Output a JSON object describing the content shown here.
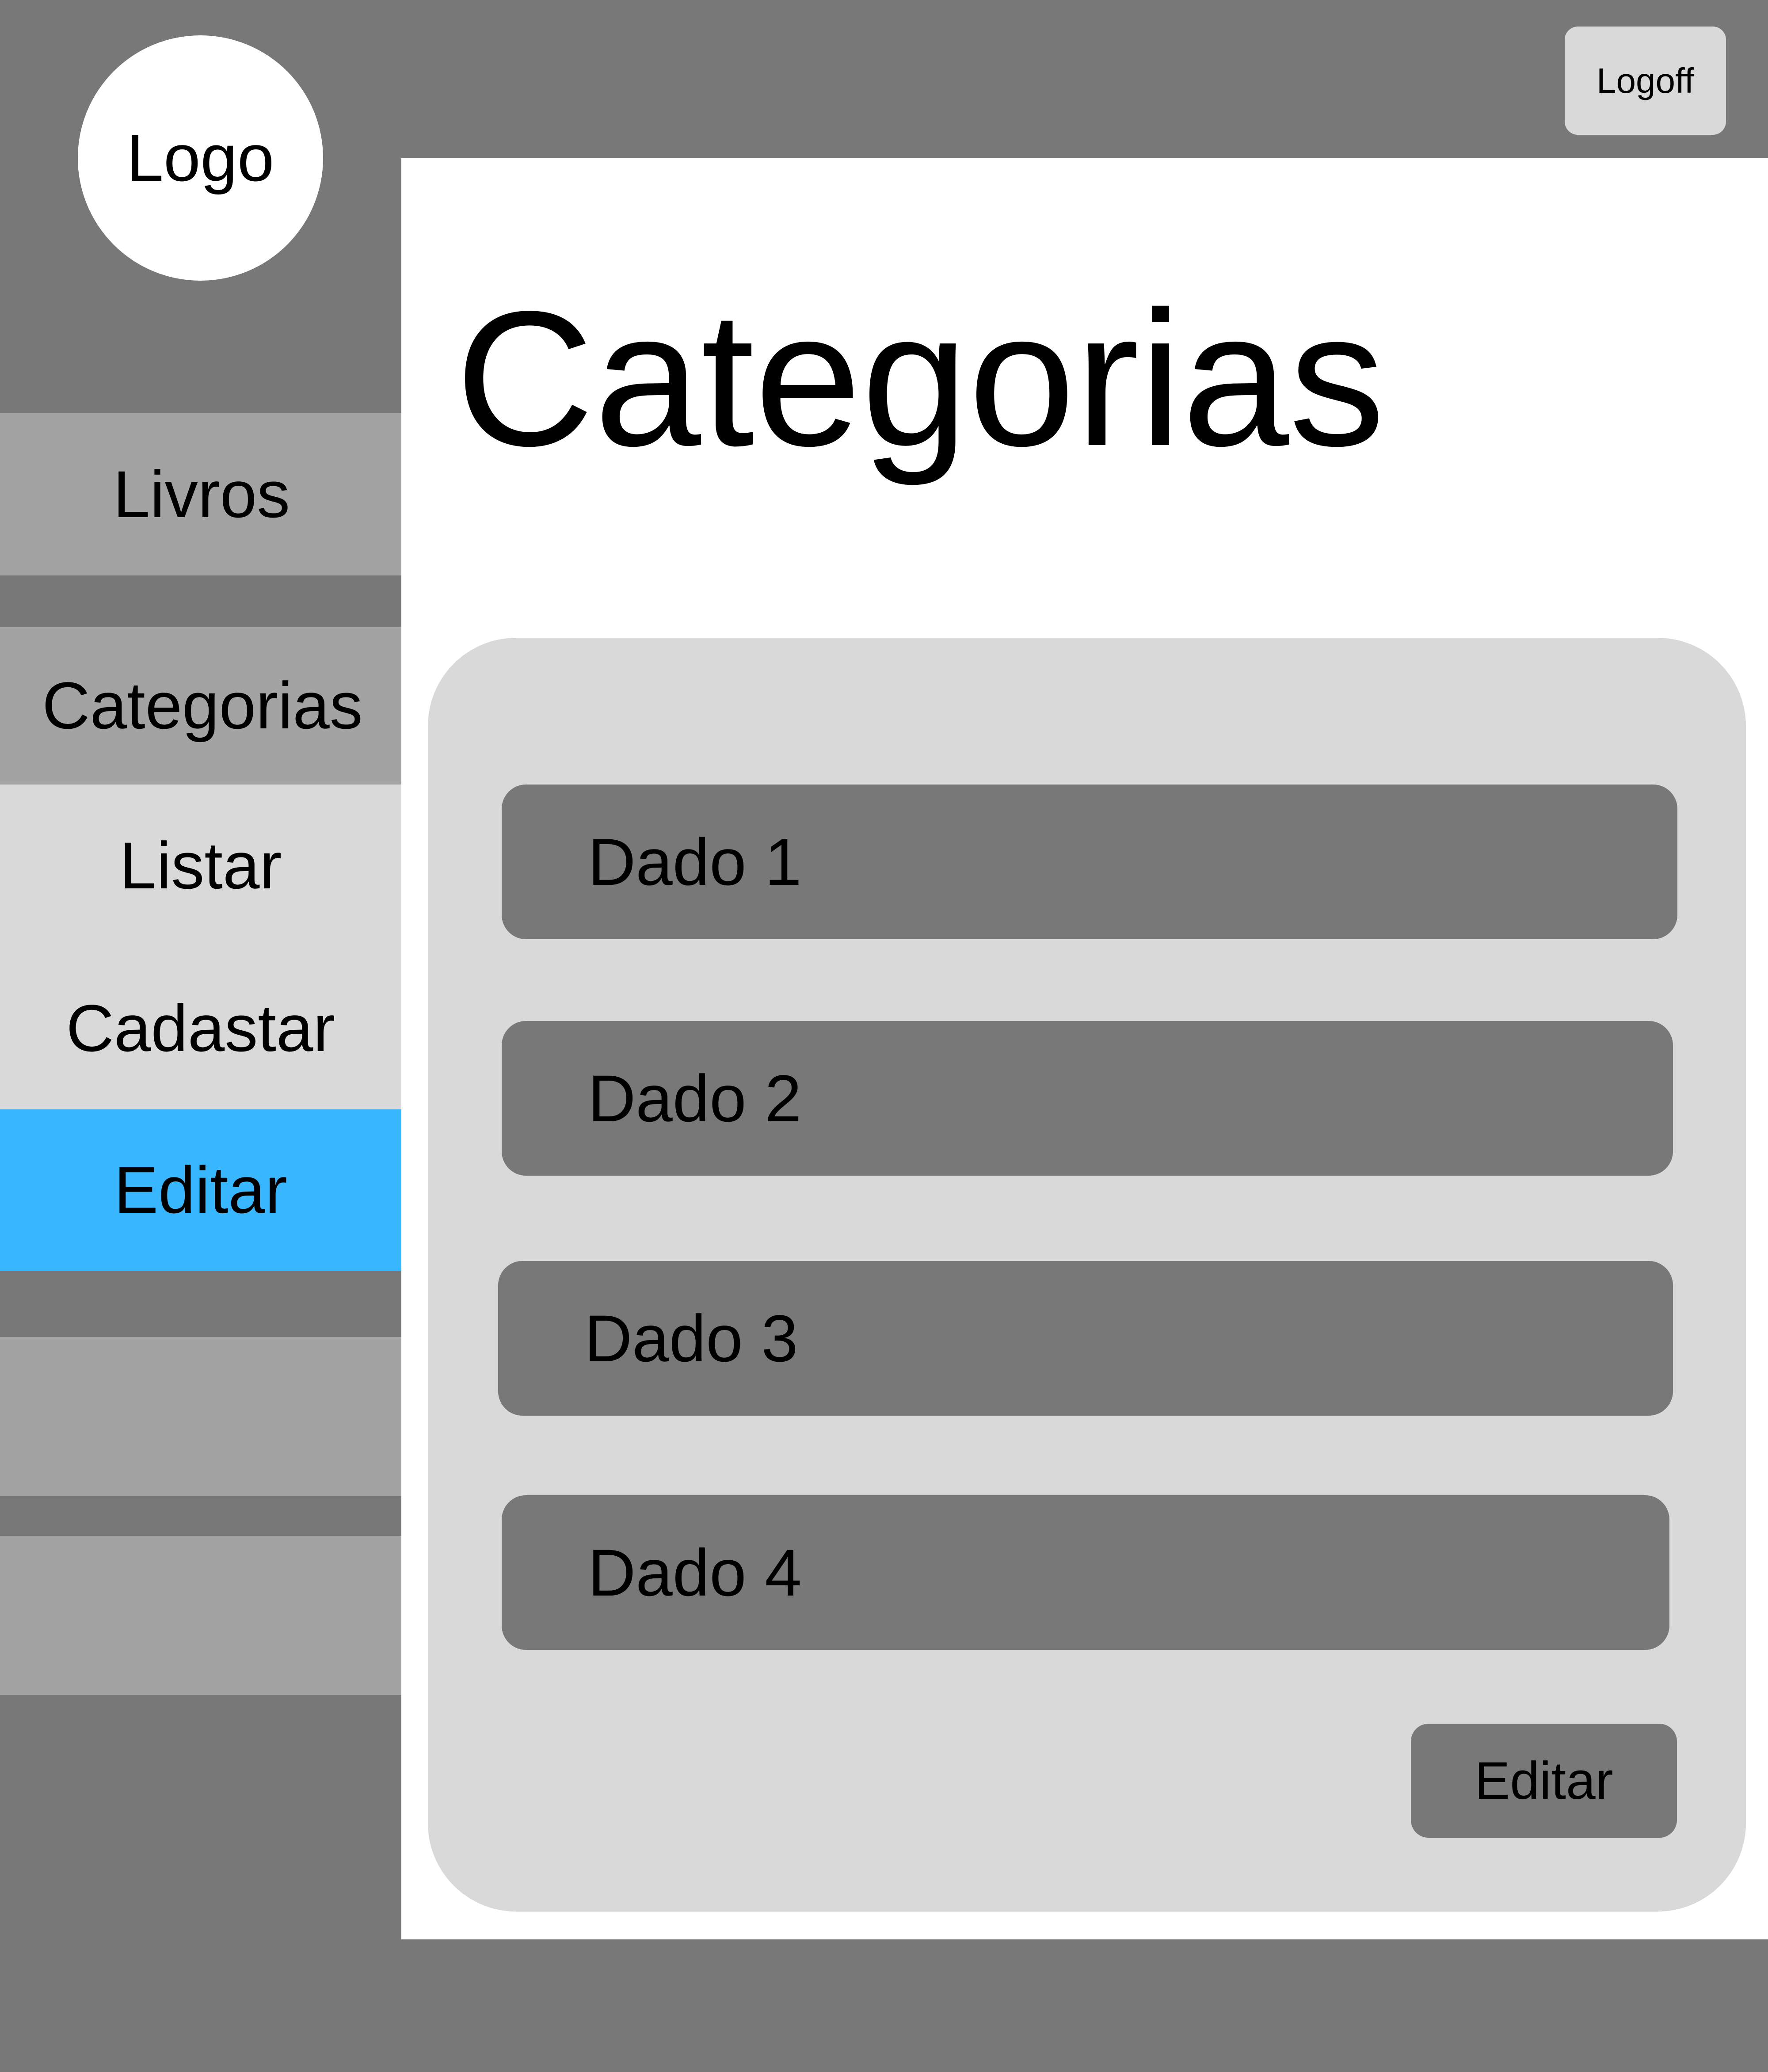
{
  "header": {
    "logo_text": "Logo",
    "logoff_label": "Logoff"
  },
  "sidebar": {
    "items": [
      {
        "label": "Livros"
      },
      {
        "label": "Categorias"
      },
      {
        "label": "Listar"
      },
      {
        "label": "Cadastar"
      },
      {
        "label": "Editar",
        "active": true
      }
    ],
    "active_color": "#38b6ff"
  },
  "main": {
    "title": "Categorias",
    "rows": [
      "Dado 1",
      "Dado 2",
      "Dado 3",
      "Dado 4"
    ],
    "edit_label": "Editar"
  },
  "colors": {
    "background": "#787878",
    "panel": "#d9d9d9",
    "sidebar_item": "#a3a3a3",
    "row": "#787878"
  }
}
